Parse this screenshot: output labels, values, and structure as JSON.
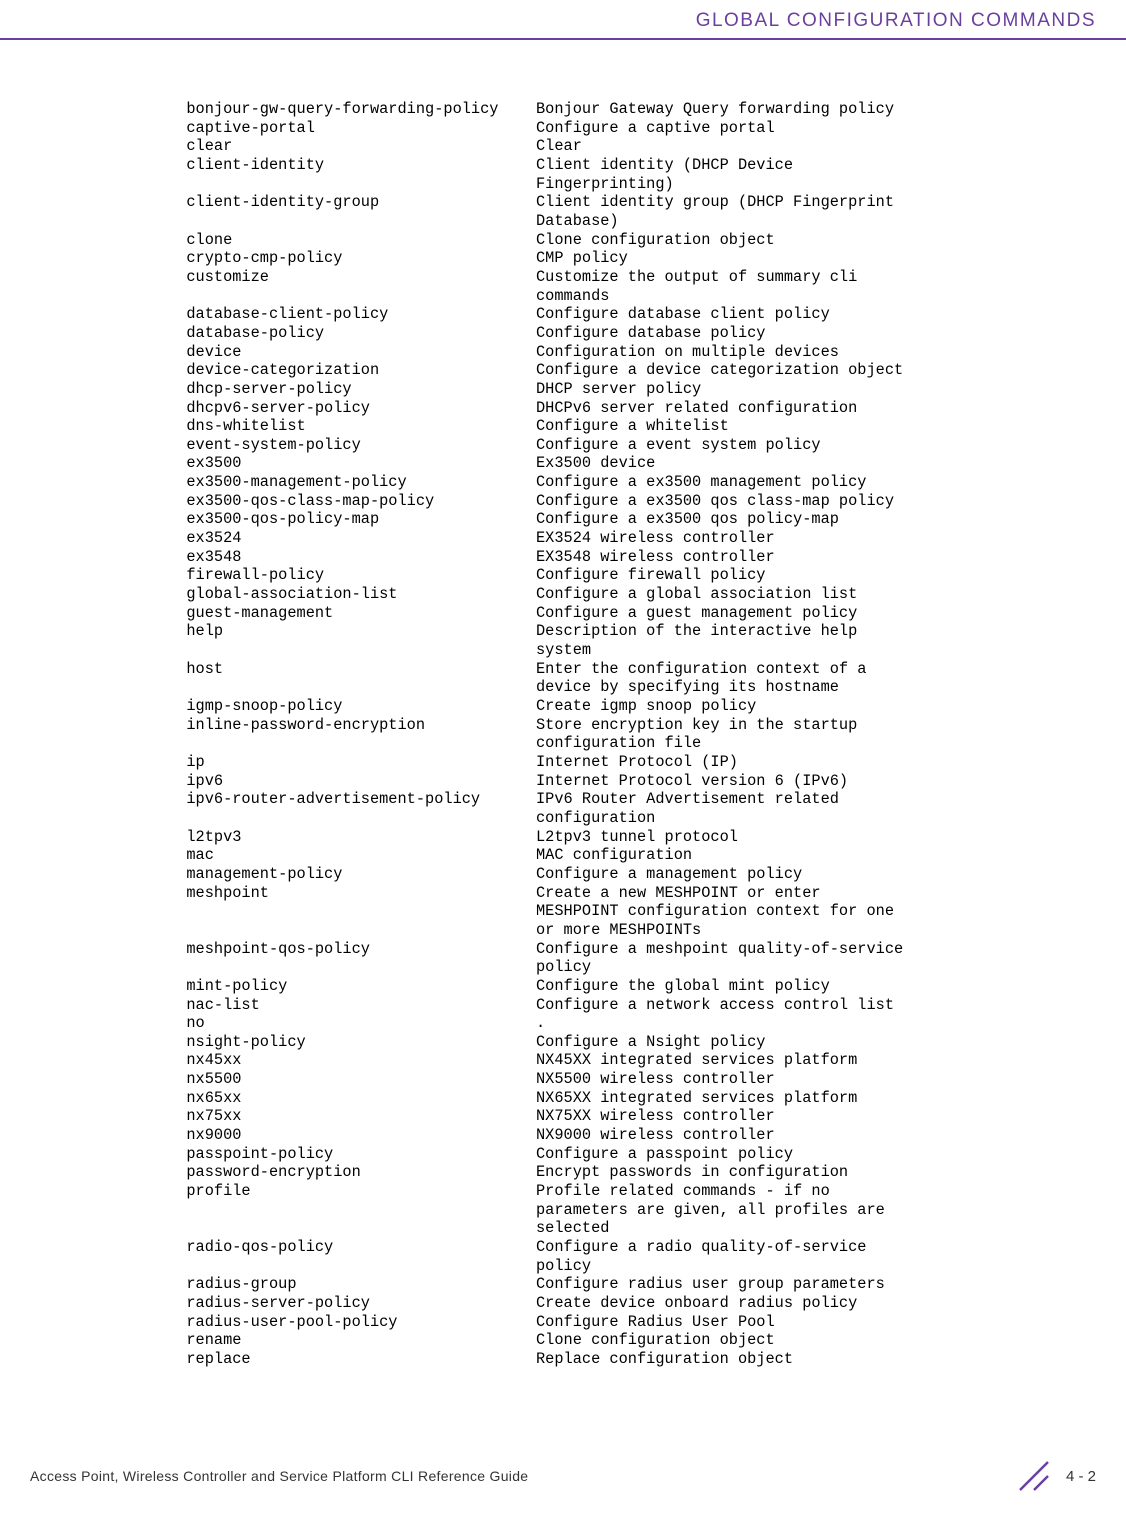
{
  "header": {
    "title": "GLOBAL CONFIGURATION COMMANDS"
  },
  "commands": [
    {
      "cmd": "bonjour-gw-query-forwarding-policy",
      "desc": [
        "Bonjour Gateway Query forwarding policy"
      ]
    },
    {
      "cmd": "captive-portal",
      "desc": [
        "Configure a captive portal"
      ]
    },
    {
      "cmd": "clear",
      "desc": [
        "Clear"
      ]
    },
    {
      "cmd": "client-identity",
      "desc": [
        "Client identity (DHCP Device",
        "Fingerprinting)"
      ]
    },
    {
      "cmd": "client-identity-group",
      "desc": [
        "Client identity group (DHCP Fingerprint",
        "Database)"
      ]
    },
    {
      "cmd": "clone",
      "desc": [
        "Clone configuration object"
      ]
    },
    {
      "cmd": "crypto-cmp-policy",
      "desc": [
        "CMP policy"
      ]
    },
    {
      "cmd": "customize",
      "desc": [
        "Customize the output of summary cli",
        "commands"
      ]
    },
    {
      "cmd": "database-client-policy",
      "desc": [
        "Configure database client policy"
      ]
    },
    {
      "cmd": "database-policy",
      "desc": [
        "Configure database policy"
      ]
    },
    {
      "cmd": "device",
      "desc": [
        "Configuration on multiple devices"
      ]
    },
    {
      "cmd": "device-categorization",
      "desc": [
        "Configure a device categorization object"
      ]
    },
    {
      "cmd": "dhcp-server-policy",
      "desc": [
        "DHCP server policy"
      ]
    },
    {
      "cmd": "dhcpv6-server-policy",
      "desc": [
        "DHCPv6 server related configuration"
      ]
    },
    {
      "cmd": "dns-whitelist",
      "desc": [
        "Configure a whitelist"
      ]
    },
    {
      "cmd": "event-system-policy",
      "desc": [
        "Configure a event system policy"
      ]
    },
    {
      "cmd": "ex3500",
      "desc": [
        "Ex3500 device"
      ]
    },
    {
      "cmd": "ex3500-management-policy",
      "desc": [
        "Configure a ex3500 management policy"
      ]
    },
    {
      "cmd": "ex3500-qos-class-map-policy",
      "desc": [
        "Configure a ex3500 qos class-map policy"
      ]
    },
    {
      "cmd": "ex3500-qos-policy-map",
      "desc": [
        "Configure a ex3500 qos policy-map"
      ]
    },
    {
      "cmd": "ex3524",
      "desc": [
        "EX3524 wireless controller"
      ]
    },
    {
      "cmd": "ex3548",
      "desc": [
        "EX3548 wireless controller"
      ]
    },
    {
      "cmd": "firewall-policy",
      "desc": [
        "Configure firewall policy"
      ]
    },
    {
      "cmd": "global-association-list",
      "desc": [
        "Configure a global association list"
      ]
    },
    {
      "cmd": "guest-management",
      "desc": [
        "Configure a guest management policy"
      ]
    },
    {
      "cmd": "help",
      "desc": [
        "Description of the interactive help",
        "system"
      ]
    },
    {
      "cmd": "host",
      "desc": [
        "Enter the configuration context of a",
        "device by specifying its hostname"
      ]
    },
    {
      "cmd": "igmp-snoop-policy",
      "desc": [
        "Create igmp snoop policy"
      ]
    },
    {
      "cmd": "inline-password-encryption",
      "desc": [
        "Store encryption key in the startup",
        "configuration file"
      ]
    },
    {
      "cmd": "ip",
      "desc": [
        "Internet Protocol (IP)"
      ]
    },
    {
      "cmd": "ipv6",
      "desc": [
        "Internet Protocol version 6 (IPv6)"
      ]
    },
    {
      "cmd": "ipv6-router-advertisement-policy",
      "desc": [
        "IPv6 Router Advertisement related",
        "configuration"
      ]
    },
    {
      "cmd": "l2tpv3",
      "desc": [
        "L2tpv3 tunnel protocol"
      ]
    },
    {
      "cmd": "mac",
      "desc": [
        "MAC configuration"
      ]
    },
    {
      "cmd": "management-policy",
      "desc": [
        "Configure a management policy"
      ]
    },
    {
      "cmd": "meshpoint",
      "desc": [
        "Create a new MESHPOINT or enter",
        "MESHPOINT configuration context for one",
        "or more MESHPOINTs"
      ]
    },
    {
      "cmd": "meshpoint-qos-policy",
      "desc": [
        "Configure a meshpoint quality-of-service",
        "policy"
      ]
    },
    {
      "cmd": "mint-policy",
      "desc": [
        "Configure the global mint policy"
      ]
    },
    {
      "cmd": "nac-list",
      "desc": [
        "Configure a network access control list"
      ]
    },
    {
      "cmd": "no",
      "desc": [
        "."
      ]
    },
    {
      "cmd": "nsight-policy",
      "desc": [
        "Configure a Nsight policy"
      ]
    },
    {
      "cmd": "nx45xx",
      "desc": [
        "NX45XX integrated services platform"
      ]
    },
    {
      "cmd": "nx5500",
      "desc": [
        "NX5500 wireless controller"
      ]
    },
    {
      "cmd": "nx65xx",
      "desc": [
        "NX65XX integrated services platform"
      ]
    },
    {
      "cmd": "nx75xx",
      "desc": [
        "NX75XX wireless controller"
      ]
    },
    {
      "cmd": "nx9000",
      "desc": [
        "NX9000 wireless controller"
      ]
    },
    {
      "cmd": "passpoint-policy",
      "desc": [
        "Configure a passpoint policy"
      ]
    },
    {
      "cmd": "password-encryption",
      "desc": [
        "Encrypt passwords in configuration"
      ]
    },
    {
      "cmd": "profile",
      "desc": [
        "Profile related commands - if no",
        "parameters are given, all profiles are",
        "selected"
      ]
    },
    {
      "cmd": "radio-qos-policy",
      "desc": [
        "Configure a radio quality-of-service",
        "policy"
      ]
    },
    {
      "cmd": "radius-group",
      "desc": [
        "Configure radius user group parameters"
      ]
    },
    {
      "cmd": "radius-server-policy",
      "desc": [
        "Create device onboard radius policy"
      ]
    },
    {
      "cmd": "radius-user-pool-policy",
      "desc": [
        "Configure Radius User Pool"
      ]
    },
    {
      "cmd": "rename",
      "desc": [
        "Clone configuration object"
      ]
    },
    {
      "cmd": "replace",
      "desc": [
        "Replace configuration object"
      ]
    }
  ],
  "footer": {
    "text": "Access Point, Wireless Controller and Service Platform CLI Reference Guide",
    "page": "4 - 2"
  }
}
